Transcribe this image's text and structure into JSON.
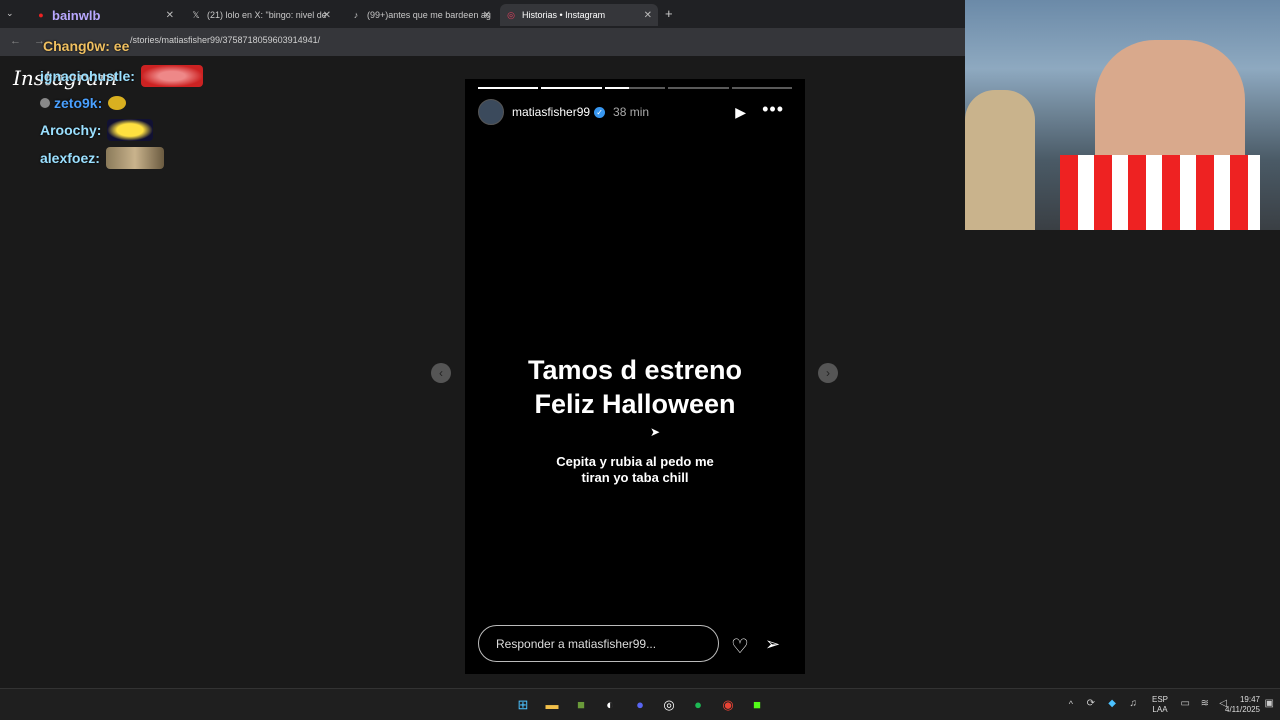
{
  "browser": {
    "tabs": [
      {
        "label": "bainwlb",
        "icon": "stream-icon",
        "active": false
      },
      {
        "label": "(21) lolo en X: \"bingo: nivel de",
        "icon": "x-logo-icon",
        "active": false
      },
      {
        "label": "(99+)antes que me bardeen ag",
        "icon": "tiktok-icon",
        "active": false
      },
      {
        "label": "Historias • Instagram",
        "icon": "instagram-icon",
        "active": true
      }
    ],
    "url": "/stories/matiasfisher99/3758718059603914941/"
  },
  "sidebar": {
    "logo": "Instagram",
    "chat": [
      {
        "user": "Chang0w: ee",
        "color": "#f0c060"
      },
      {
        "user": "ignaciohustle:",
        "color": "#9be0ff"
      },
      {
        "user": "zeto9k:",
        "color": "#4aa0ff"
      },
      {
        "user": "Aroochy:",
        "color": "#9be0ff"
      },
      {
        "user": "alexfoez:",
        "color": "#9be0ff"
      }
    ]
  },
  "story": {
    "username": "matiasfisher99",
    "time": "38 min",
    "headline_line1": "Tamos d estreno",
    "headline_line2": "Feliz Halloween",
    "sub_line1": "Cepita y rubia al pedo me",
    "sub_line2": "tiran yo taba chill",
    "reply_placeholder": "Responder a matiasfisher99...",
    "progress": [
      1,
      1,
      0.4,
      0,
      0
    ]
  },
  "taskbar": {
    "lang1": "ESP",
    "lang2": "LAA",
    "time": "19:47",
    "date": "4/11/2025",
    "icons": [
      "windows-start-icon",
      "file-explorer-icon",
      "minecraft-icon",
      "steam-icon",
      "discord-icon",
      "obs-icon",
      "spotify-icon",
      "chrome-icon",
      "kick-icon"
    ]
  },
  "colors": {
    "accent": "#3897f0",
    "background": "#1a1a1a"
  }
}
